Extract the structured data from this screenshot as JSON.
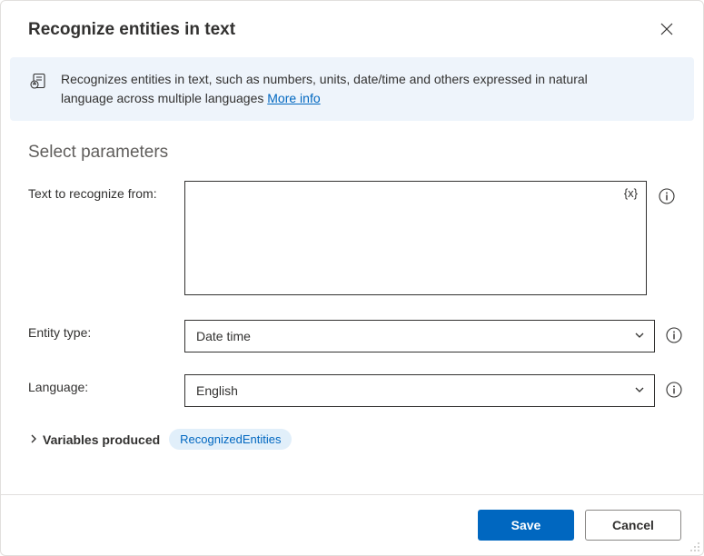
{
  "dialog": {
    "title": "Recognize entities in text",
    "close_label": "Close"
  },
  "banner": {
    "text": "Recognizes entities in text, such as numbers, units, date/time and others expressed in natural language across multiple languages ",
    "link_label": "More info"
  },
  "section": {
    "title": "Select parameters"
  },
  "fields": {
    "text": {
      "label": "Text to recognize from:",
      "value": "",
      "var_token": "{x}"
    },
    "entity_type": {
      "label": "Entity type:",
      "value": "Date time"
    },
    "language": {
      "label": "Language:",
      "value": "English"
    }
  },
  "variables": {
    "header": "Variables produced",
    "chip": "RecognizedEntities"
  },
  "footer": {
    "save": "Save",
    "cancel": "Cancel"
  }
}
